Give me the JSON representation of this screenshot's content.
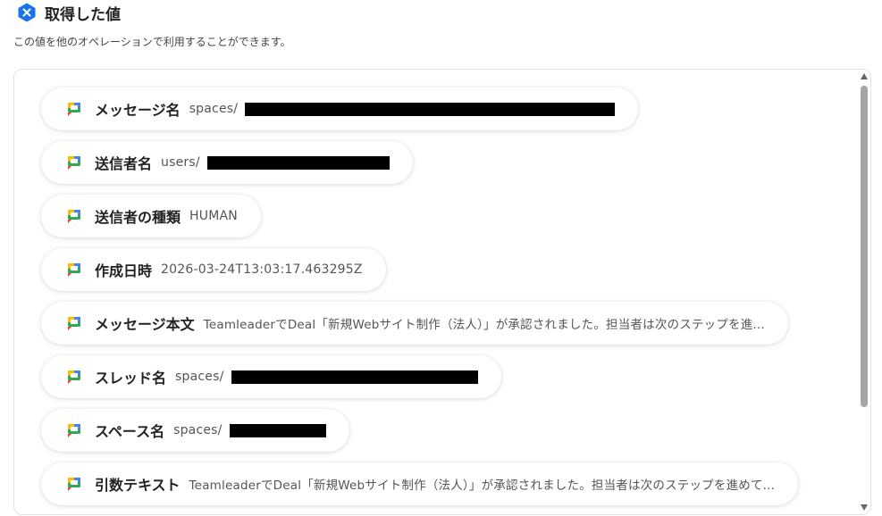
{
  "header": {
    "icon": "close-icon",
    "title": "取得した値",
    "subtitle": "この値を他のオペレーションで利用することができます。"
  },
  "colors": {
    "brand_blue": "#1a73e8",
    "chat_green": "#34a853",
    "chat_yellow": "#fbbc04",
    "chat_blue": "#4285f4",
    "chat_red": "#ea4335"
  },
  "items": [
    {
      "icon": "google-chat-icon",
      "label": "メッセージ名",
      "value": "spaces/",
      "redacted": true
    },
    {
      "icon": "google-chat-icon",
      "label": "送信者名",
      "value": "users/",
      "redacted": true
    },
    {
      "icon": "google-chat-icon",
      "label": "送信者の種類",
      "value": "HUMAN",
      "redacted": false
    },
    {
      "icon": "google-chat-icon",
      "label": "作成日時",
      "value": "2026-03-24T13:03:17.463295Z",
      "redacted": false
    },
    {
      "icon": "google-chat-icon",
      "label": "メッセージ本文",
      "value": "TeamleaderでDeal「新規Webサイト制作（法人）」が承認されました。担当者は次のステップを進...",
      "redacted": false
    },
    {
      "icon": "google-chat-icon",
      "label": "スレッド名",
      "value": "spaces/",
      "redacted": true
    },
    {
      "icon": "google-chat-icon",
      "label": "スペース名",
      "value": "spaces/",
      "redacted": true
    },
    {
      "icon": "google-chat-icon",
      "label": "引数テキスト",
      "value": "TeamleaderでDeal「新規Webサイト制作（法人）」が承認されました。担当者は次のステップを進めて...",
      "redacted": false
    }
  ]
}
